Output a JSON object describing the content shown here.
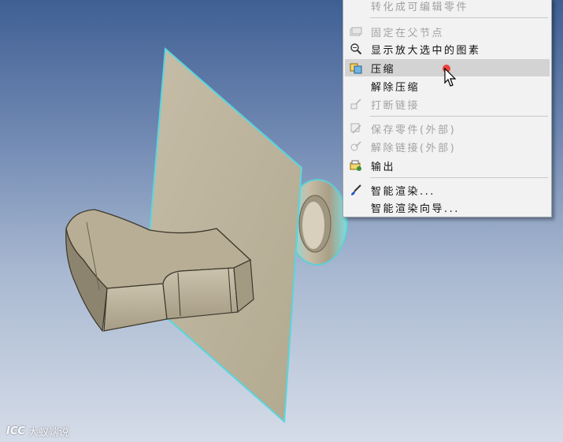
{
  "context_menu": {
    "items": [
      {
        "label": "转化成可编辑零件",
        "disabled": true,
        "icon": "none"
      },
      {
        "label": "固定在父节点",
        "disabled": true,
        "icon": "pin-layers-icon"
      },
      {
        "label": "显示放大选中的图素",
        "disabled": false,
        "icon": "zoom-selection-icon"
      },
      {
        "label": "压缩",
        "disabled": false,
        "icon": "suppress-icon",
        "highlighted": true
      },
      {
        "label": "解除压缩",
        "disabled": false,
        "icon": "none"
      },
      {
        "label": "打断链接",
        "disabled": true,
        "icon": "break-link-icon"
      },
      {
        "label": "保存零件(外部)",
        "disabled": true,
        "icon": "save-external-icon"
      },
      {
        "label": "解除链接(外部)",
        "disabled": true,
        "icon": "unlink-external-icon"
      },
      {
        "label": "输出",
        "disabled": false,
        "icon": "export-icon"
      },
      {
        "label": "智能渲染...",
        "disabled": false,
        "icon": "paint-brush-icon"
      },
      {
        "label": "智能渲染向导...",
        "disabled": false,
        "icon": "none"
      }
    ]
  },
  "colors": {
    "part_face": "#b5ab93",
    "plane_edge": "#59d6dc",
    "highlight": "#d3d3d3",
    "cursor_marker": "#e8453c"
  },
  "watermark": {
    "logo_text": "ICC",
    "text": "大蚁端说"
  }
}
